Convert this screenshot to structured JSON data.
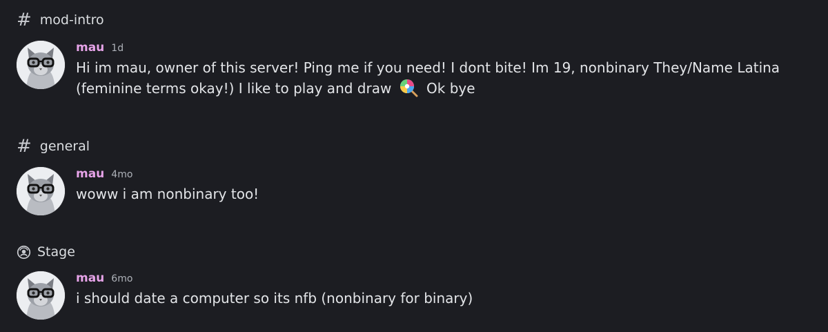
{
  "sections": [
    {
      "channel": {
        "icon": "hash-icon",
        "name": "mod-intro"
      },
      "message": {
        "author": "mau",
        "timestamp": "1d",
        "text_before_emoji": "Hi im mau, owner of this server! Ping me if you need! I dont bite! Im 19, nonbinary They/Name Latina (feminine terms okay!) I like to play and draw",
        "emoji": "lollipop",
        "text_after_emoji": "Ok bye",
        "avatar": "cat-with-glasses-avatar"
      }
    },
    {
      "channel": {
        "icon": "hash-icon",
        "name": "general"
      },
      "message": {
        "author": "mau",
        "timestamp": "4mo",
        "text": "woww i am nonbinary too!",
        "avatar": "cat-with-glasses-avatar"
      }
    },
    {
      "channel": {
        "icon": "stage-icon",
        "name": "Stage"
      },
      "message": {
        "author": "mau",
        "timestamp": "6mo",
        "text": "i should date a computer so its nfb (nonbinary for binary)",
        "avatar": "cat-with-glasses-avatar"
      }
    }
  ],
  "colors": {
    "background": "#1c1d22",
    "author": "#e6a3e8",
    "text": "#e3e5e8",
    "timestamp": "#aeb2b9"
  }
}
